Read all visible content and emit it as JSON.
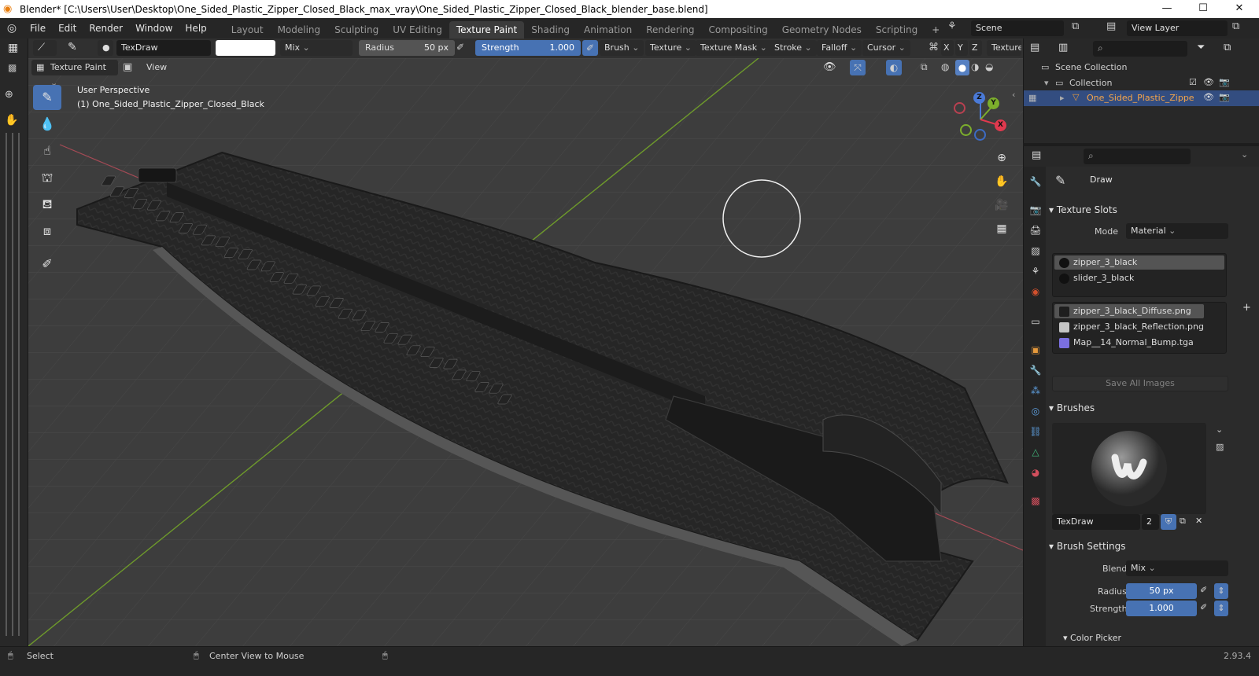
{
  "window": {
    "title": "Blender* [C:\\Users\\User\\Desktop\\One_Sided_Plastic_Zipper_Closed_Black_max_vray\\One_Sided_Plastic_Zipper_Closed_Black_blender_base.blend]",
    "min": "—",
    "max": "☐",
    "close": "✕"
  },
  "menus": [
    "File",
    "Edit",
    "Render",
    "Window",
    "Help"
  ],
  "workspaces": [
    "Layout",
    "Modeling",
    "Sculpting",
    "UV Editing",
    "Texture Paint",
    "Shading",
    "Animation",
    "Rendering",
    "Compositing",
    "Geometry Nodes",
    "Scripting"
  ],
  "active_workspace": "Texture Paint",
  "add_workspace": "+",
  "scene": "Scene",
  "view_layer": "View Layer",
  "toolheader": {
    "brush_name": "TexDraw",
    "blend": "Mix",
    "radius_label": "Radius",
    "radius_value": "50 px",
    "strength_label": "Strength",
    "strength_value": "1.000",
    "menus": [
      "Brush",
      "Texture",
      "Texture Mask",
      "Stroke",
      "Falloff",
      "Cursor"
    ],
    "axes": [
      "X",
      "Y",
      "Z"
    ],
    "texture_tab": "Texture"
  },
  "viewport_header": {
    "mode": "Texture Paint",
    "view_menu": "View"
  },
  "viewport": {
    "perspective": "User Perspective",
    "object_label": "(1) One_Sided_Plastic_Zipper_Closed_Black",
    "gizmo": {
      "x": "X",
      "y": "Y",
      "z": "Z"
    }
  },
  "outliner": {
    "scene_collection": "Scene Collection",
    "collection": "Collection",
    "object": "One_Sided_Plastic_Zippe"
  },
  "properties": {
    "tool_name": "Draw",
    "texture_slots_header": "Texture Slots",
    "mode_label": "Mode",
    "mode_value": "Material",
    "materials": [
      "zipper_3_black",
      "slider_3_black"
    ],
    "images": [
      {
        "name": "zipper_3_black_Diffuse.png",
        "color": "#1e1e1e"
      },
      {
        "name": "zipper_3_black_Reflection.png",
        "color": "#c4c4c4"
      },
      {
        "name": "Map__14_Normal_Bump.tga",
        "color": "#7b6fe0"
      }
    ],
    "save_all": "Save All Images",
    "brushes_header": "Brushes",
    "brush_datablock": "TexDraw",
    "brush_users": "2",
    "brush_settings_header": "Brush Settings",
    "blend_label": "Blend",
    "blend_value": "Mix",
    "radius_label": "Radius",
    "radius_value": "50 px",
    "strength_label": "Strength",
    "strength_value": "1.000",
    "color_picker": "Color Picker"
  },
  "statusbar": {
    "select": "Select",
    "center_view": "Center View to Mouse",
    "version": "2.93.4"
  }
}
